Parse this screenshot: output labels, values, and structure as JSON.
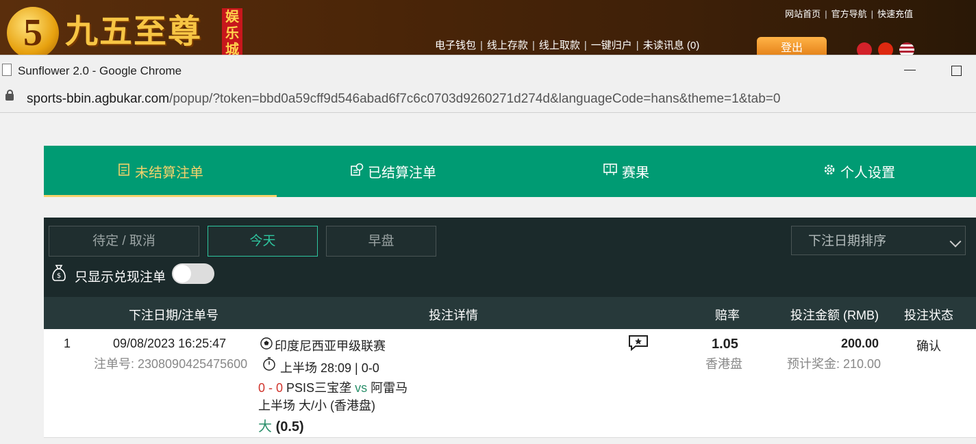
{
  "site": {
    "logo_digit": "5",
    "logo_text": "九五至尊",
    "logo_tag": "娱乐城",
    "top_links": [
      "网站首页",
      "官方导航",
      "快速充值"
    ],
    "mid_links": [
      "电子钱包",
      "线上存款",
      "线上取款",
      "一键归户",
      "未读讯息 (0)"
    ],
    "logout": "登出"
  },
  "chrome": {
    "window_title": "Sunflower 2.0 - Google Chrome",
    "url_host": "sports-bbin.agbukar.com",
    "url_path": "/popup/?token=bbd0a59cff9d546abad6f7c6c0703d9260271d274d&languageCode=hans&theme=1&tab=0"
  },
  "nav_tabs": [
    {
      "label": "未结算注单",
      "icon": "receipt-icon",
      "active": true
    },
    {
      "label": "已结算注单",
      "icon": "settled-icon",
      "active": false
    },
    {
      "label": "赛果",
      "icon": "scoreboard-icon",
      "active": false
    },
    {
      "label": "个人设置",
      "icon": "gear-icon",
      "active": false
    }
  ],
  "filters": {
    "pending": "待定 / 取消",
    "today": "今天",
    "early": "早盘",
    "sort": "下注日期排序",
    "cashout_only": "只显示兑现注单",
    "cashout_toggle_on": false
  },
  "table": {
    "headers": [
      "下注日期/注单号",
      "投注详情",
      "赔率",
      "投注金额 (RMB)",
      "投注状态"
    ],
    "rows": [
      {
        "index": "1",
        "datetime": "09/08/2023 16:25:47",
        "bet_no": "注单号: 2308090425475600",
        "league": "印度尼西亚甲级联赛",
        "live_status": "上半场 28:09 | 0-0",
        "score": "0 - 0",
        "home": "PSIS三宝垄",
        "vs": "vs",
        "away": "阿雷马",
        "market": "上半场 大/小 (香港盘)",
        "selection": "大",
        "selection_line": "(0.5)",
        "odds": "1.05",
        "odds_type": "香港盘",
        "stake": "200.00",
        "potential": "预计奖金: 210.00",
        "status": "确认"
      }
    ]
  },
  "colors": {
    "tab_bar": "#009b73",
    "active_tab": "#f5d26b",
    "dark_panel": "#1b2a2b",
    "table_header": "#27393a",
    "accent_green": "#2ec7a0",
    "score_red": "#d0342c"
  }
}
